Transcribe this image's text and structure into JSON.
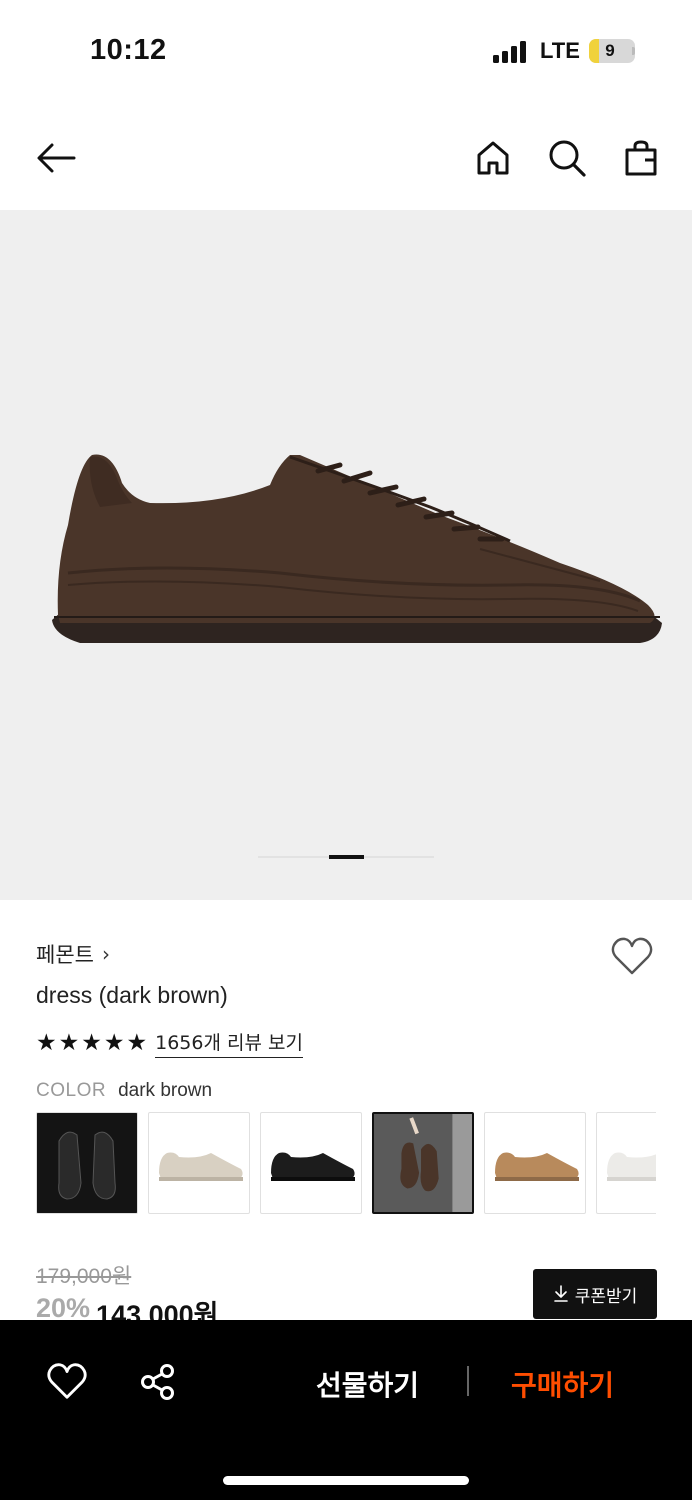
{
  "status_bar": {
    "time": "10:12",
    "network": "LTE",
    "battery_level": "9",
    "battery_fraction": 0.09
  },
  "nav": {
    "back_icon": "arrow-left-icon",
    "home_icon": "home-icon",
    "search_icon": "search-icon",
    "bag_icon": "shopping-bag-icon"
  },
  "hero": {
    "image_desc_icon": "suede-sneaker-dark-brown",
    "pager_active_index": 1,
    "pager_count": 5
  },
  "product": {
    "brand": "페몬트",
    "brand_chevron": "›",
    "name": "dress (dark brown)",
    "rating": 5,
    "stars": [
      "★",
      "★",
      "★",
      "★",
      "★"
    ],
    "review_link": "1656개 리뷰 보기",
    "color_label": "COLOR",
    "color_value": "dark brown"
  },
  "swatches": [
    {
      "name": "black-leather",
      "selected": false
    },
    {
      "name": "beige",
      "selected": false
    },
    {
      "name": "black",
      "selected": false
    },
    {
      "name": "dark-brown",
      "selected": true
    },
    {
      "name": "tan-brown",
      "selected": false
    },
    {
      "name": "white",
      "selected": false
    }
  ],
  "price": {
    "original": "179,000원",
    "discount": "20%",
    "current": "143,000원"
  },
  "coupon": {
    "label": "쿠폰받기",
    "icon": "download-icon"
  },
  "bottom_bar": {
    "wish_icon": "heart-icon",
    "share_icon": "share-icon",
    "gift_label": "선물하기",
    "buy_label": "구매하기",
    "buy_color": "#ff4d00"
  }
}
